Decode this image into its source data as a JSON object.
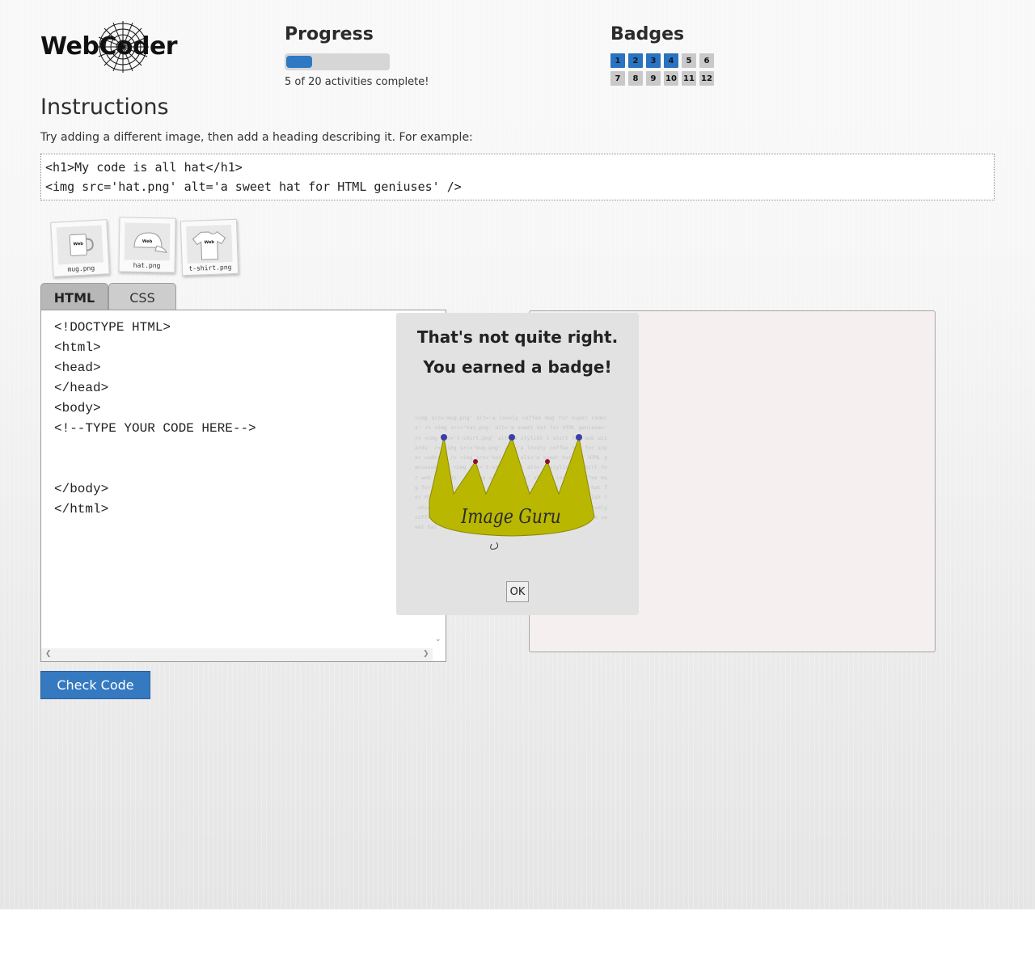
{
  "header": {
    "logo_text": "WebCoder",
    "progress": {
      "title": "Progress",
      "completed": 5,
      "total": 20,
      "fraction": 0.25,
      "status_text": "5 of 20 activities complete!"
    },
    "badges": {
      "title": "Badges",
      "items": [
        {
          "label": "1",
          "earned": true
        },
        {
          "label": "2",
          "earned": true
        },
        {
          "label": "3",
          "earned": true
        },
        {
          "label": "4",
          "earned": true
        },
        {
          "label": "5",
          "earned": false
        },
        {
          "label": "6",
          "earned": false
        },
        {
          "label": "7",
          "earned": false
        },
        {
          "label": "8",
          "earned": false
        },
        {
          "label": "9",
          "earned": false
        },
        {
          "label": "10",
          "earned": false
        },
        {
          "label": "11",
          "earned": false
        },
        {
          "label": "12",
          "earned": false
        }
      ]
    }
  },
  "instructions": {
    "title": "Instructions",
    "text": "Try adding a different image, then add a heading describing it. For example:",
    "example_lines": [
      "<h1>My code is all hat</h1>",
      "<img src='hat.png' alt='a sweet hat for HTML geniuses' />"
    ]
  },
  "images": [
    {
      "label": "mug.png",
      "icon": "mug-icon"
    },
    {
      "label": "hat.png",
      "icon": "hat-icon"
    },
    {
      "label": "t-shirt.png",
      "icon": "tshirt-icon"
    }
  ],
  "tabs": [
    {
      "label": "HTML",
      "active": true
    },
    {
      "label": "CSS",
      "active": false
    }
  ],
  "editor": {
    "lines": [
      "<!DOCTYPE HTML>",
      "<html>",
      "<head>",
      "</head>",
      "<body>",
      "<!--TYPE YOUR CODE HERE-->",
      "",
      "",
      "</body>",
      "</html>"
    ]
  },
  "check_button": "Check Code",
  "modal": {
    "line1": "That's not quite right.",
    "line2": "You earned a badge!",
    "badge_name": "Image Guru",
    "badge_background_text": "<img src='mug.png' alt='a lovely coffee mug for super coders' /> <img src='hat.png' alt='a sweet hat for HTML geniuses' /> <img src='t-shirt.png' alt='a stylish t-shirt for web wizards' /> <img src='mug.png' alt='a lovely coffee mug for super coders' /> <img src='hat.png' alt='a sweet hat for HTML geniuses' /> <img src='t-shirt.png' alt='a stylish t-shirt for web wizards' /> <img src='mug.png' alt='a lovely coffee mug for super coders' /> <img src='hat.png' alt='a sweet hat for HTML geniuses' /> <img src='t-shirt.png' alt='a stylish t-shirt for web wizards' /> <img src='mug.png' alt='a lovely coffee mug for super coders' /> <img src='hat.png' alt='a sweet hat for HTML geniuses' />",
    "ok_label": "OK",
    "colors": {
      "crown": "#b9b700",
      "gem_blue": "#3b3fa8",
      "gem_red": "#8b1020"
    }
  },
  "colors": {
    "accent": "#3579c1",
    "progress_fill": "#2f78c4",
    "badge_earned": "#2a73c0",
    "badge_locked": "#c9c9c9"
  }
}
